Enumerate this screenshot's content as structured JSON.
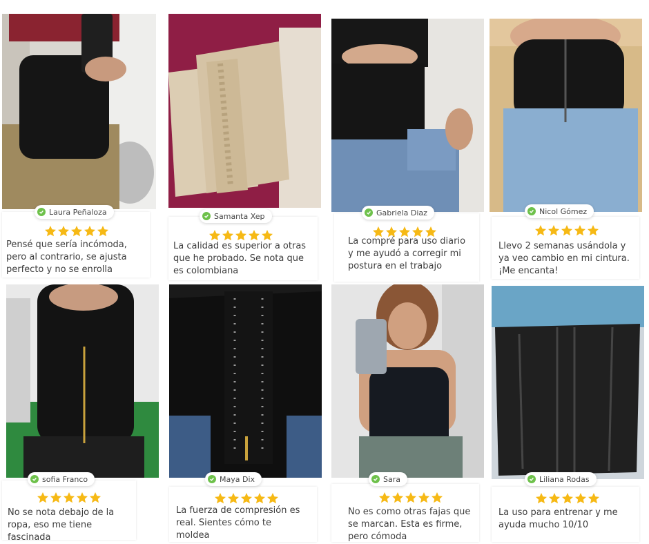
{
  "colors": {
    "star": "#f6b915",
    "check": "#6ec14b"
  },
  "reviews": [
    {
      "name": "Laura Peñaloza",
      "rating": 5,
      "text": "Pensé que sería incómoda, pero al contrario, se ajusta perfecto y no se enrolla"
    },
    {
      "name": "Samanta Xep",
      "rating": 5,
      "text": "La calidad es superior a otras que he probado. Se nota que es colombiana"
    },
    {
      "name": "Gabriela Diaz",
      "rating": 5,
      "text": "La compré para uso diario y me ayudó a corregir mi postura en el trabajo"
    },
    {
      "name": "Nicol Gómez",
      "rating": 5,
      "text": "Llevo 2 semanas usándola y ya veo cambio en mi cintura. ¡Me encanta!"
    },
    {
      "name": "sofia  Franco",
      "rating": 5,
      "text": "No se nota debajo de la ropa, eso me tiene fascinada"
    },
    {
      "name": "Maya Dix",
      "rating": 5,
      "text": "La fuerza de compresión es real. Sientes cómo te moldea"
    },
    {
      "name": "Sara",
      "rating": 5,
      "text": "No es como otras fajas que se marcan. Esta es firme, pero cómoda"
    },
    {
      "name": "Liliana  Rodas",
      "rating": 5,
      "text": "La uso para entrenar y me ayuda mucho 10/10"
    }
  ]
}
